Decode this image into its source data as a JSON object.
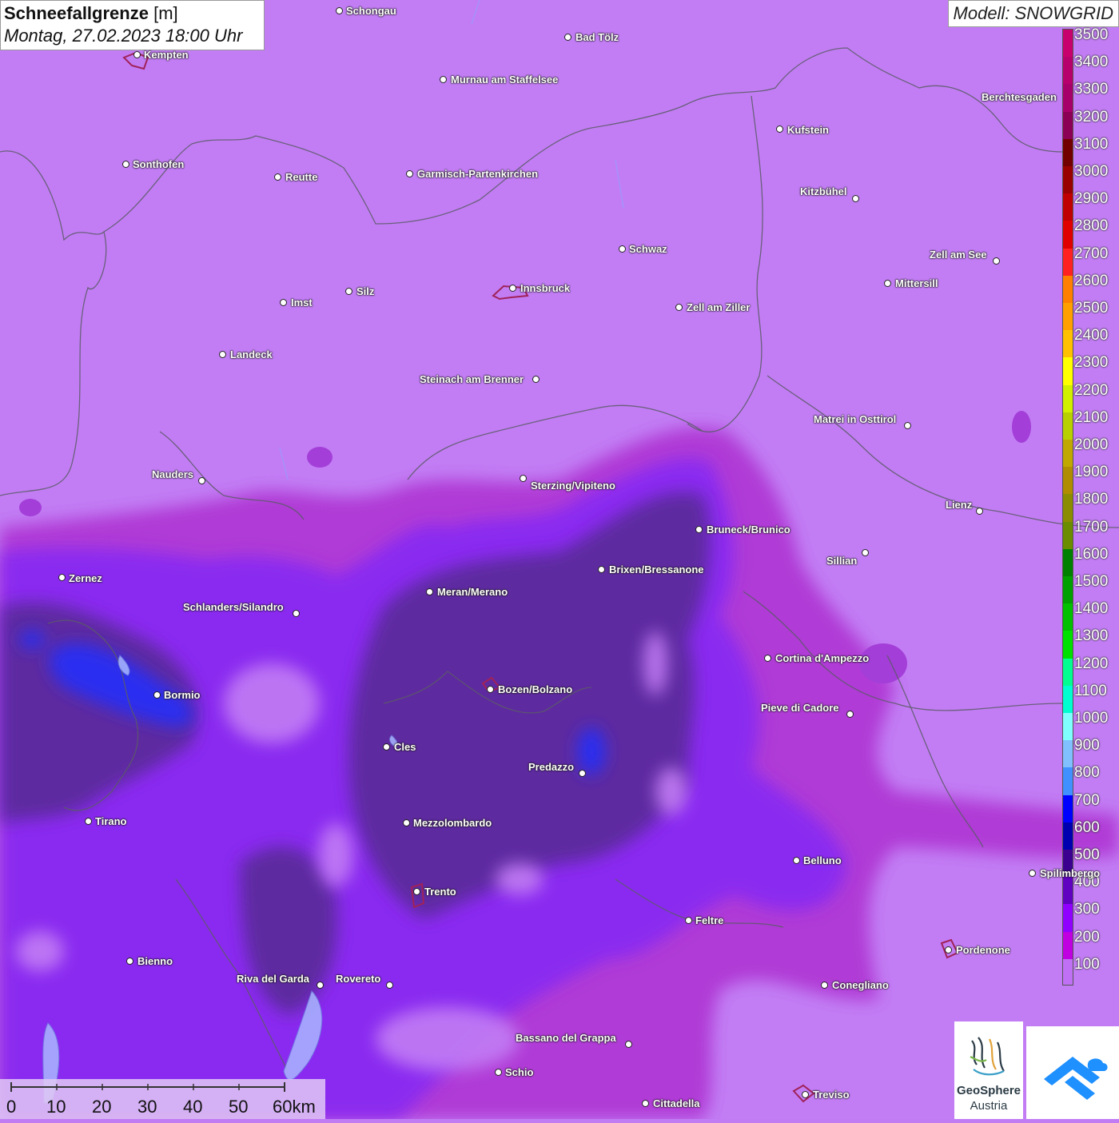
{
  "header": {
    "title_bold": "Schneefallgrenze",
    "title_unit": "[m]",
    "datetime": "Montag, 27.02.2023 18:00 Uhr",
    "model": "Modell: SNOWGRID"
  },
  "legend": {
    "labels": [
      "3500",
      "3400",
      "3300",
      "3200",
      "3100",
      "3000",
      "2900",
      "2800",
      "2700",
      "2600",
      "2500",
      "2400",
      "2300",
      "2200",
      "2100",
      "2000",
      "1900",
      "1800",
      "1700",
      "1600",
      "1500",
      "1400",
      "1300",
      "1200",
      "1100",
      "1000",
      "900",
      "800",
      "700",
      "600",
      "500",
      "400",
      "300",
      "200",
      "100"
    ],
    "colors": [
      "#c8006e",
      "#b8006c",
      "#a8006a",
      "#8c0055",
      "#720000",
      "#990000",
      "#c00000",
      "#e00000",
      "#ff2020",
      "#ff8000",
      "#ffa000",
      "#ffc000",
      "#ffff00",
      "#d0f000",
      "#b8d000",
      "#c0a800",
      "#b08c00",
      "#8c8c00",
      "#6c8c00",
      "#008000",
      "#00a000",
      "#00c000",
      "#00e000",
      "#00ff90",
      "#00ffd0",
      "#80ffff",
      "#80c0ff",
      "#4090ff",
      "#0000ff",
      "#0000b0",
      "#3c0090",
      "#6000c0",
      "#9000ff",
      "#c000e0",
      "#c070f4"
    ]
  },
  "cities": [
    {
      "name": "Schongau",
      "dot_side": "left"
    },
    {
      "name": "Kempten",
      "dot_side": "left"
    },
    {
      "name": "Bad Tölz",
      "dot_side": "left"
    },
    {
      "name": "Murnau am Staffelsee",
      "dot_side": "left"
    },
    {
      "name": "Berchtesgaden",
      "dot_side": "right"
    },
    {
      "name": "Kufstein",
      "dot_side": "left"
    },
    {
      "name": "Sonthofen",
      "dot_side": "left"
    },
    {
      "name": "Reutte",
      "dot_side": "left"
    },
    {
      "name": "Garmisch-Partenkirchen",
      "dot_side": "left"
    },
    {
      "name": "Kitzbühel",
      "dot_side": "right"
    },
    {
      "name": "Schwaz",
      "dot_side": "left"
    },
    {
      "name": "Zell am See",
      "dot_side": "right"
    },
    {
      "name": "Innsbruck",
      "dot_side": "left"
    },
    {
      "name": "Silz",
      "dot_side": "left"
    },
    {
      "name": "Imst",
      "dot_side": "left"
    },
    {
      "name": "Mittersill",
      "dot_side": "left"
    },
    {
      "name": "Zell am Ziller",
      "dot_side": "left"
    },
    {
      "name": "Landeck",
      "dot_side": "left"
    },
    {
      "name": "Steinach am Brenner",
      "dot_side": "right"
    },
    {
      "name": "Matrei in Osttirol",
      "dot_side": "right"
    },
    {
      "name": "Nauders",
      "dot_side": "right"
    },
    {
      "name": "Sterzing/Vipiteno",
      "dot_side": "left"
    },
    {
      "name": "Lienz",
      "dot_side": "right"
    },
    {
      "name": "Bruneck/Brunico",
      "dot_side": "left"
    },
    {
      "name": "Sillian",
      "dot_side": "right"
    },
    {
      "name": "Zernez",
      "dot_side": "left"
    },
    {
      "name": "Brixen/Bressanone",
      "dot_side": "left"
    },
    {
      "name": "Meran/Merano",
      "dot_side": "left"
    },
    {
      "name": "Schlanders/Silandro",
      "dot_side": "right"
    },
    {
      "name": "Cortina d'Ampezzo",
      "dot_side": "left"
    },
    {
      "name": "Bozen/Bolzano",
      "dot_side": "left"
    },
    {
      "name": "Bormio",
      "dot_side": "left"
    },
    {
      "name": "Pieve di Cadore",
      "dot_side": "right"
    },
    {
      "name": "Cles",
      "dot_side": "left"
    },
    {
      "name": "Predazzo",
      "dot_side": "right"
    },
    {
      "name": "Tirano",
      "dot_side": "left"
    },
    {
      "name": "Mezzolombardo",
      "dot_side": "left"
    },
    {
      "name": "Belluno",
      "dot_side": "left"
    },
    {
      "name": "Spilimbergo",
      "dot_side": "left"
    },
    {
      "name": "Trento",
      "dot_side": "left"
    },
    {
      "name": "Feltre",
      "dot_side": "left"
    },
    {
      "name": "Pordenone",
      "dot_side": "left"
    },
    {
      "name": "Bienno",
      "dot_side": "left"
    },
    {
      "name": "Riva del Garda",
      "dot_side": "right"
    },
    {
      "name": "Rovereto",
      "dot_side": "right"
    },
    {
      "name": "Conegliano",
      "dot_side": "left"
    },
    {
      "name": "Bassano del Grappa",
      "dot_side": "right"
    },
    {
      "name": "Schio",
      "dot_side": "left"
    },
    {
      "name": "Treviso",
      "dot_side": "left"
    },
    {
      "name": "Cittadella",
      "dot_side": "left"
    }
  ],
  "scale": {
    "ticks": [
      "0",
      "10",
      "20",
      "30",
      "40",
      "50",
      "60km"
    ]
  },
  "logos": {
    "geosphere_line1": "GeoSphere",
    "geosphere_line2": "Austria"
  }
}
